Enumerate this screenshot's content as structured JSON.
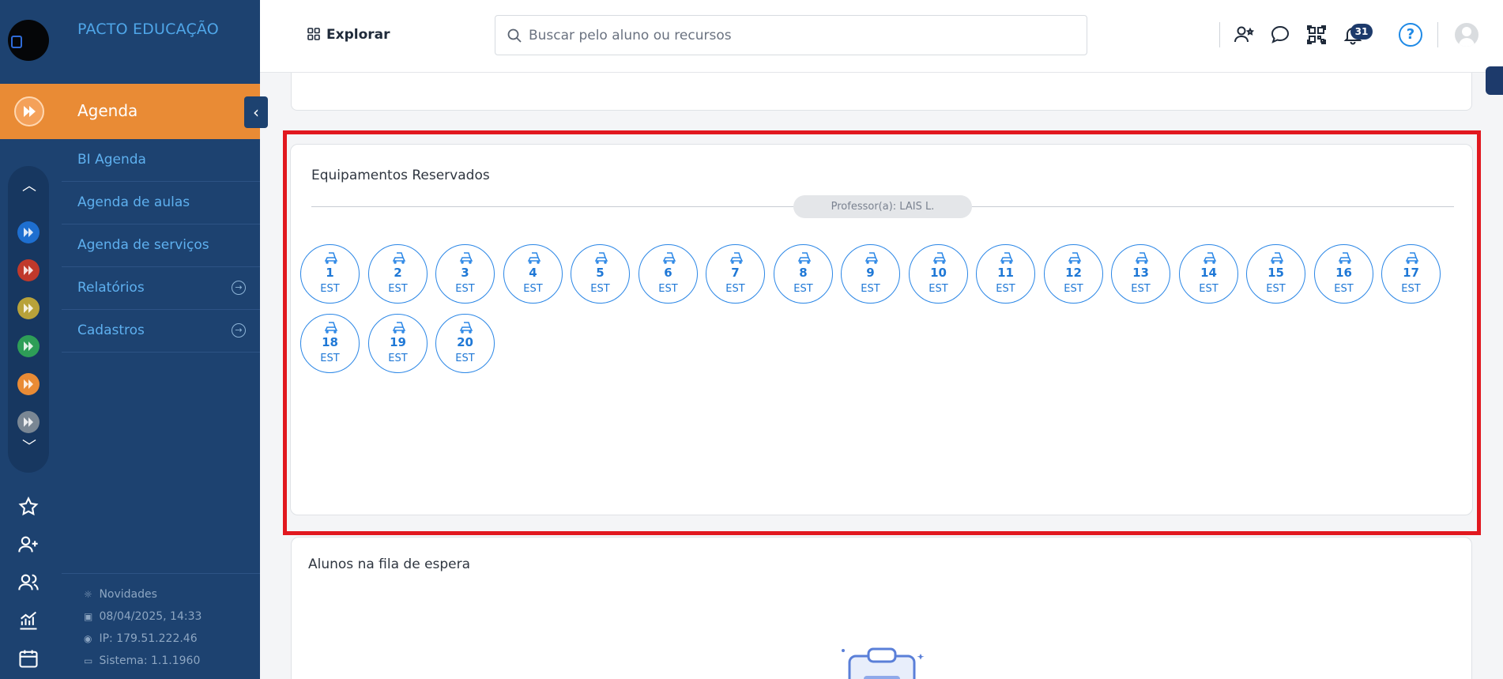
{
  "brand": "PACTO EDUCAÇÃO",
  "nav": {
    "active": "Agenda",
    "items": [
      {
        "label": "BI Agenda",
        "has_arrow": false
      },
      {
        "label": "Agenda de aulas",
        "has_arrow": false
      },
      {
        "label": "Agenda de serviços",
        "has_arrow": false
      },
      {
        "label": "Relatórios",
        "has_arrow": true
      },
      {
        "label": "Cadastros",
        "has_arrow": true
      }
    ]
  },
  "rail": {
    "module_colors": [
      "#1e6fd0",
      "#c0392b",
      "#b8a23a",
      "#2e9e57",
      "#e98b35",
      "#7a8794"
    ],
    "icons": [
      "star-icon",
      "add-user-icon",
      "users-icon",
      "chart-icon",
      "calendar-icon"
    ]
  },
  "footer": {
    "news": "Novidades",
    "datetime": "08/04/2025, 14:33",
    "ip": "IP: 179.51.222.46",
    "system": "Sistema: 1.1.1960"
  },
  "topbar": {
    "explore_label": "Explorar",
    "search_placeholder": "Buscar pelo aluno ou recursos",
    "notifications_count": "31",
    "help_label": "?"
  },
  "equipment_card": {
    "title": "Equipamentos Reservados",
    "professor": "Professor(a): LAIS L.",
    "items": [
      {
        "number": "1",
        "label": "EST"
      },
      {
        "number": "2",
        "label": "EST"
      },
      {
        "number": "3",
        "label": "EST"
      },
      {
        "number": "4",
        "label": "EST"
      },
      {
        "number": "5",
        "label": "EST"
      },
      {
        "number": "6",
        "label": "EST"
      },
      {
        "number": "7",
        "label": "EST"
      },
      {
        "number": "8",
        "label": "EST"
      },
      {
        "number": "9",
        "label": "EST"
      },
      {
        "number": "10",
        "label": "EST"
      },
      {
        "number": "11",
        "label": "EST"
      },
      {
        "number": "12",
        "label": "EST"
      },
      {
        "number": "13",
        "label": "EST"
      },
      {
        "number": "14",
        "label": "EST"
      },
      {
        "number": "15",
        "label": "EST"
      },
      {
        "number": "16",
        "label": "EST"
      },
      {
        "number": "17",
        "label": "EST"
      },
      {
        "number": "18",
        "label": "EST"
      },
      {
        "number": "19",
        "label": "EST"
      },
      {
        "number": "20",
        "label": "EST"
      }
    ]
  },
  "waitlist_card": {
    "title": "Alunos na fila de espera"
  },
  "colors": {
    "sidebar": "#1d4270",
    "accent": "#e98b35",
    "link": "#5eb0ef",
    "equipment": "#2a86e6",
    "highlight": "#e1181f"
  }
}
